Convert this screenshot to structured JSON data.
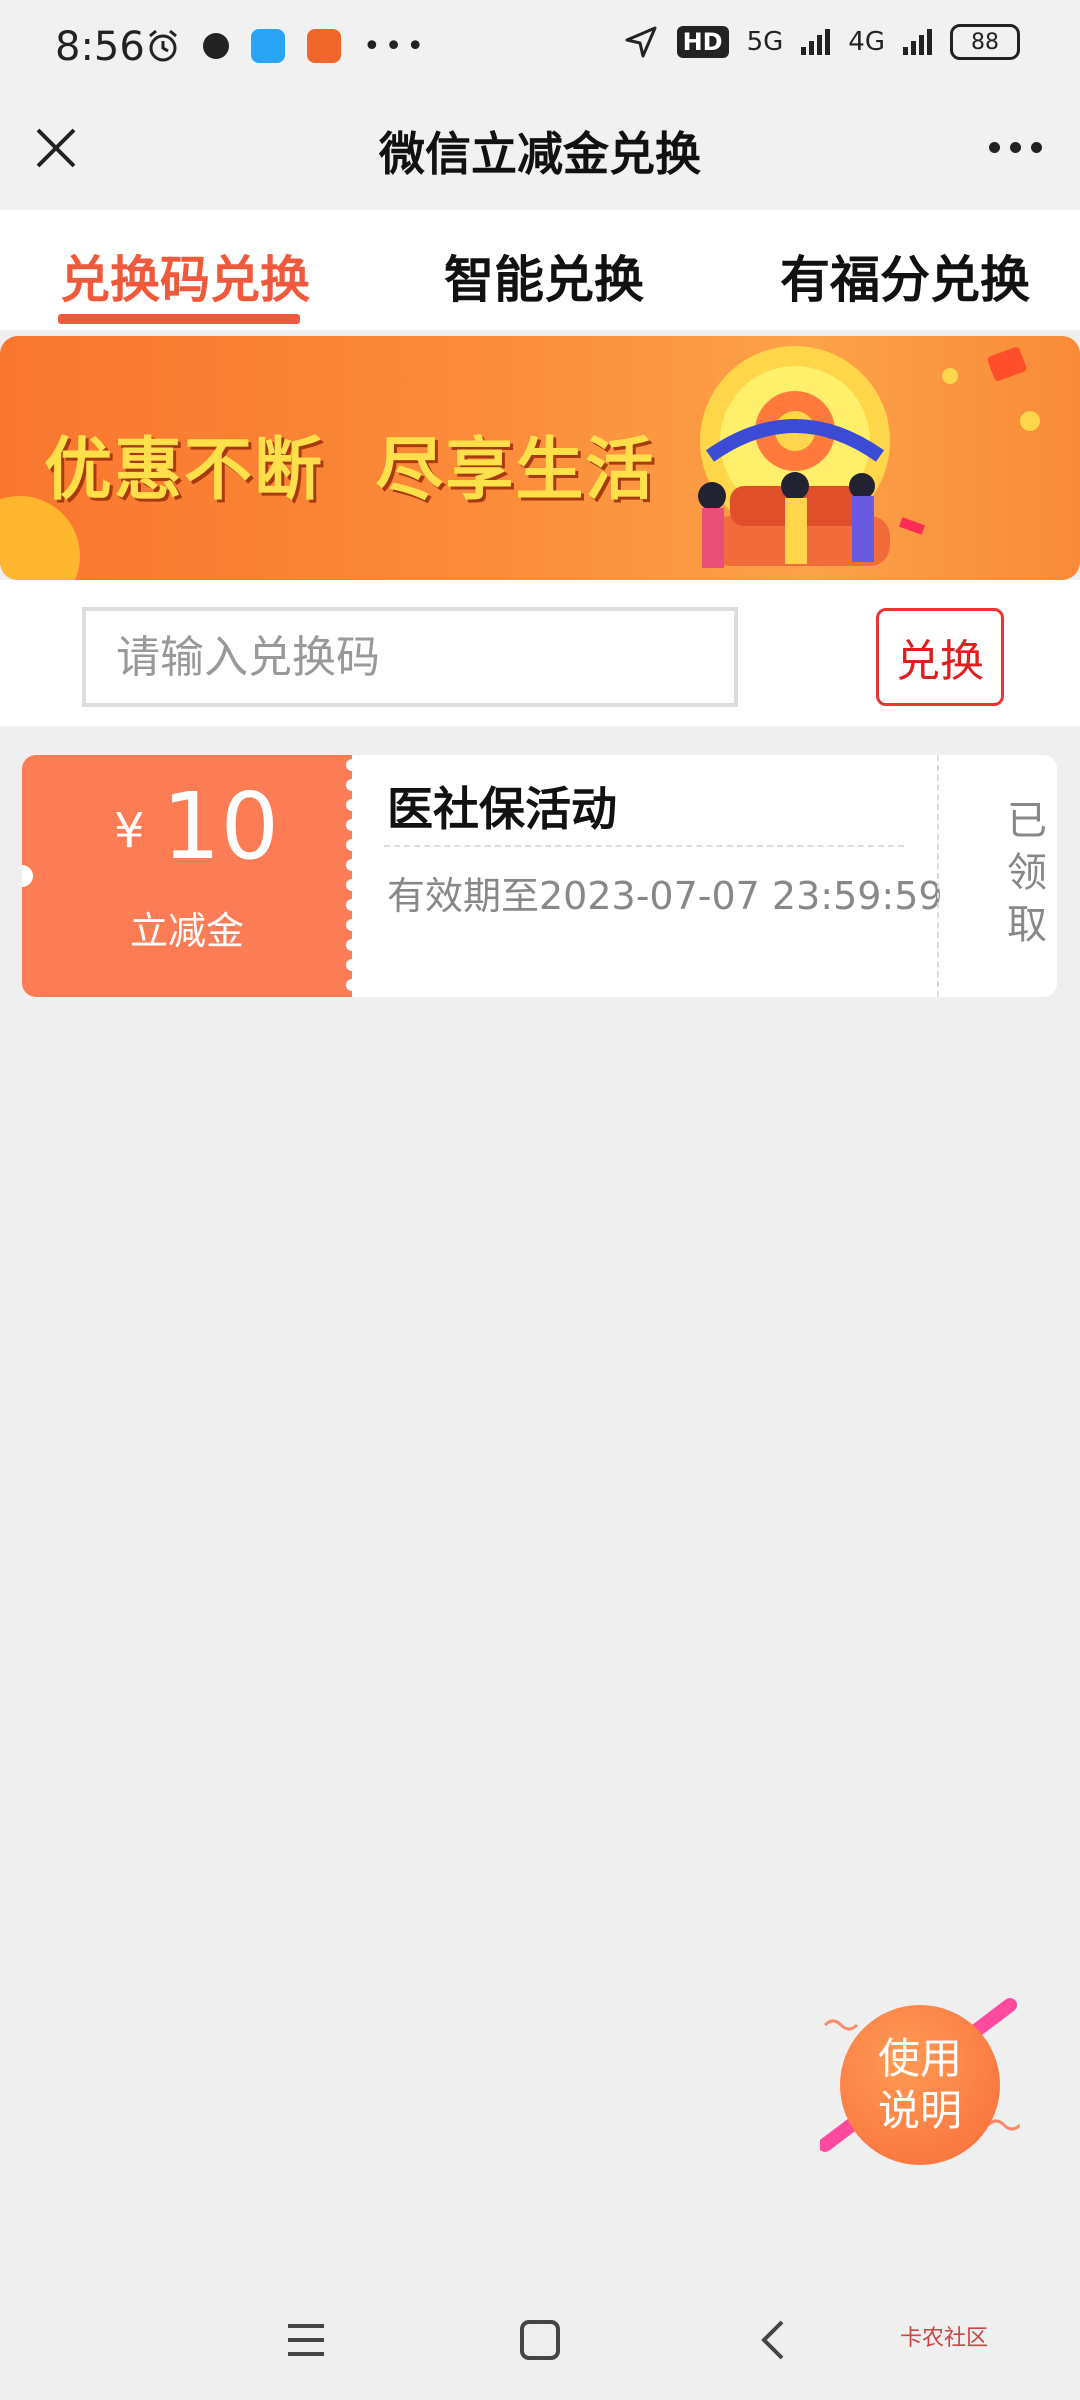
{
  "status_bar": {
    "time": "8:56",
    "hd": "HD",
    "net1": "5G",
    "net2": "4G",
    "battery": "88"
  },
  "header": {
    "title": "微信立减金兑换"
  },
  "tabs": [
    {
      "label": "兑换码兑换",
      "active": true
    },
    {
      "label": "智能兑换",
      "active": false
    },
    {
      "label": "有福分兑换",
      "active": false
    }
  ],
  "banner": {
    "text": "优惠不断  尽享生活"
  },
  "redeem": {
    "placeholder": "请输入兑换码",
    "button_label": "兑换"
  },
  "coupon": {
    "currency": "¥",
    "amount": "10",
    "type": "立减金",
    "title": "医社保活动",
    "expiry": "有效期至2023-07-07 23:59:59",
    "status": "已领取"
  },
  "help_fab": {
    "line1": "使用",
    "line2": "说明"
  },
  "watermark": "卡农社区",
  "colors": {
    "accent": "#f05a3c",
    "coupon": "#fb7c55",
    "redeem_red": "#e01e1e"
  }
}
